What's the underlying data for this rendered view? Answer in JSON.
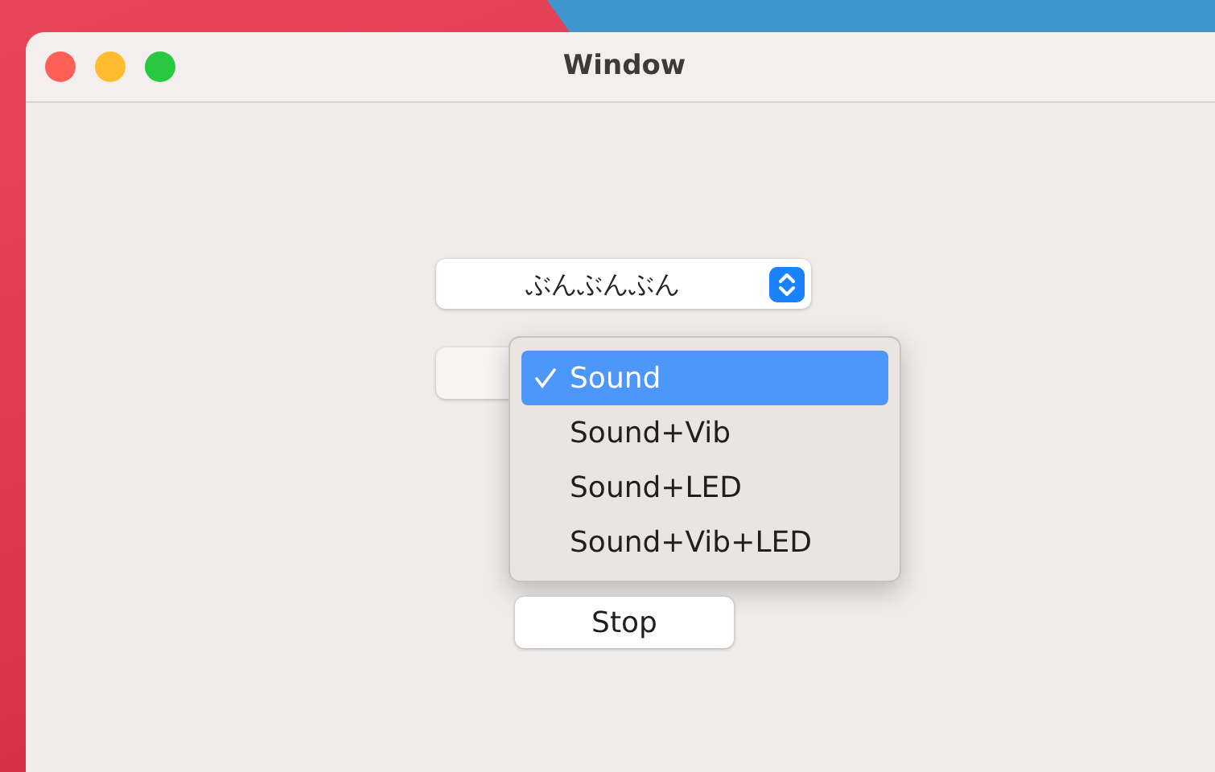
{
  "window": {
    "title": "Window"
  },
  "popup": {
    "value": "ぶんぶんぶん"
  },
  "menu": {
    "items": [
      {
        "label": "Sound",
        "selected": true
      },
      {
        "label": "Sound+Vib",
        "selected": false
      },
      {
        "label": "Sound+LED",
        "selected": false
      },
      {
        "label": "Sound+Vib+LED",
        "selected": false
      }
    ]
  },
  "buttons": [
    {
      "label": "Stop"
    }
  ]
}
